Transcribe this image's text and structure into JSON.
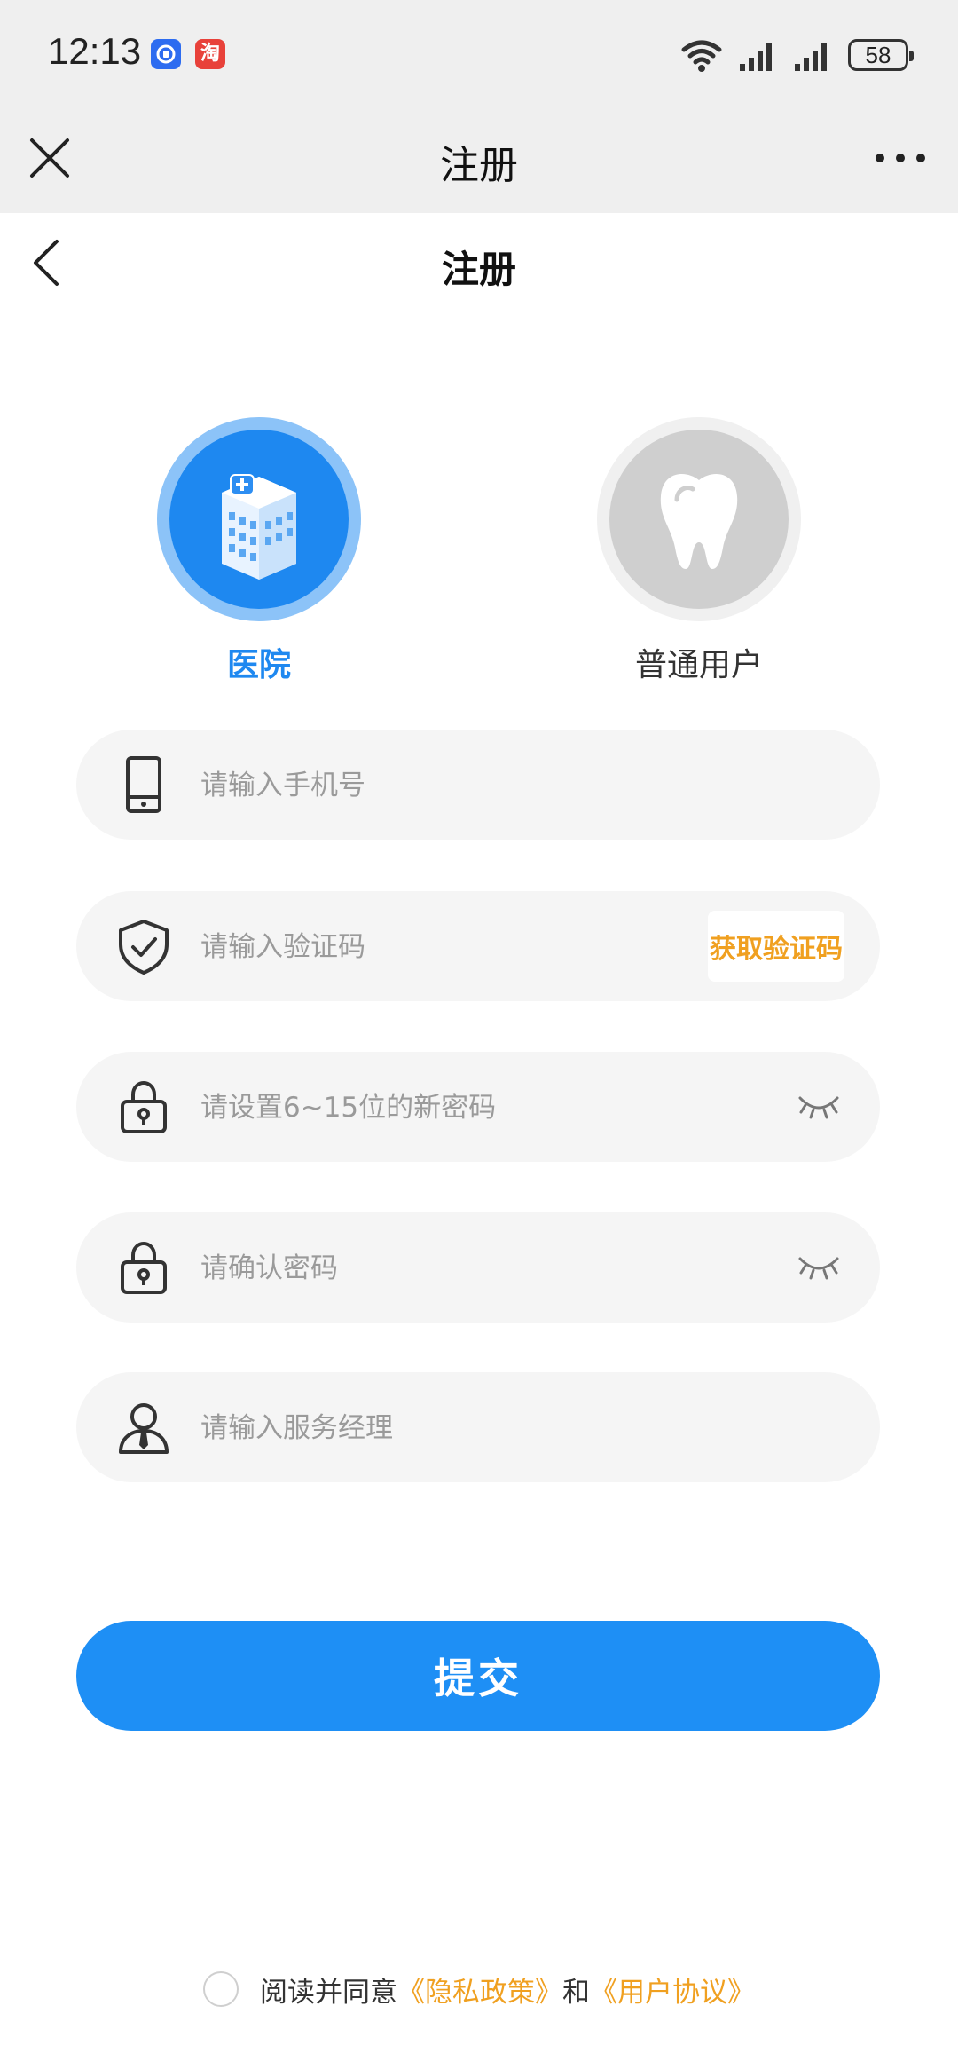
{
  "status_bar": {
    "time": "12:13",
    "battery": "58",
    "app_badge": "淘"
  },
  "app_bar": {
    "title": "注册"
  },
  "page": {
    "title": "注册"
  },
  "roles": [
    {
      "label": "医院",
      "selected": true
    },
    {
      "label": "普通用户",
      "selected": false
    }
  ],
  "form": {
    "phone_placeholder": "请输入手机号",
    "code_placeholder": "请输入验证码",
    "get_code_label": "获取验证码",
    "password_placeholder": "请设置6~15位的新密码",
    "confirm_placeholder": "请确认密码",
    "manager_placeholder": "请输入服务经理"
  },
  "submit_label": "提交",
  "agreement": {
    "prefix": "阅读并同意",
    "privacy": "《隐私政策》",
    "and": "和",
    "terms": "《用户协议》"
  },
  "colors": {
    "primary": "#1e8ff5",
    "accent": "#f0a020"
  }
}
